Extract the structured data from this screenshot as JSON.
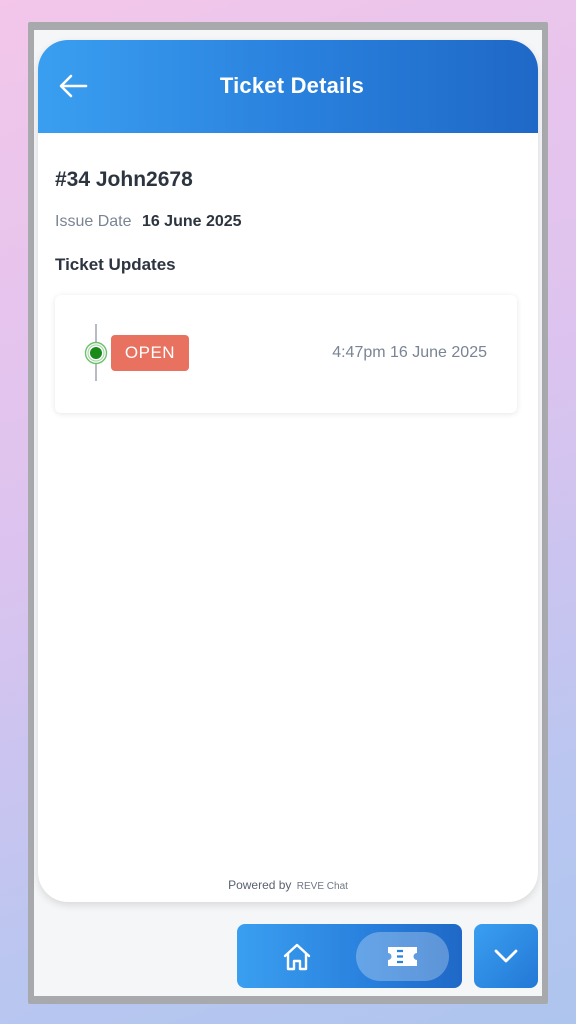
{
  "header": {
    "title": "Ticket Details",
    "back_icon": "arrow-left-icon"
  },
  "ticket": {
    "id_title": "#34 John2678",
    "issue_label": "Issue Date",
    "issue_date": "16 June 2025",
    "updates_heading": "Ticket Updates"
  },
  "updates": [
    {
      "status": "OPEN",
      "time": "4:47pm 16 June 2025",
      "status_color": "#e8715f",
      "dot_color": "#1a8a1a"
    }
  ],
  "footer": {
    "powered_by": "Powered by",
    "brand": "REVE Chat"
  },
  "nav": {
    "home_icon": "home-icon",
    "ticket_icon": "ticket-icon",
    "collapse_icon": "chevron-down-icon"
  },
  "colors": {
    "header_start": "#3a9ff0",
    "header_end": "#1f68c7",
    "text_dark": "#2c3440",
    "text_muted": "#7a8494"
  }
}
